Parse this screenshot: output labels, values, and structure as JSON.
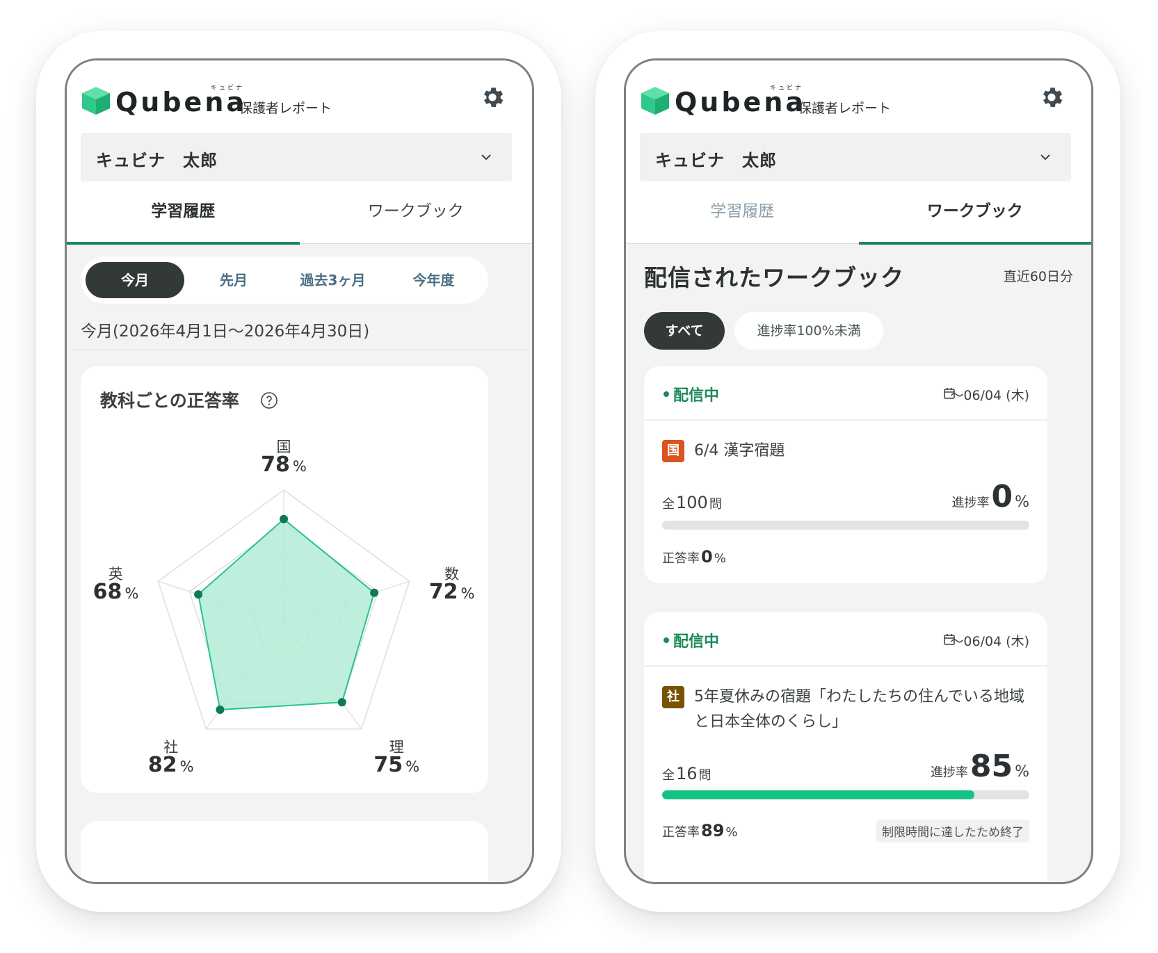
{
  "app": {
    "logo_ruby": "キュビナ",
    "logo_word": "Qubena",
    "logo_sub": "保護者レポート",
    "gear_icon": "gear-icon",
    "child_name": "キュビナ　太郎"
  },
  "tabs": [
    "学習履歴",
    "ワークブック"
  ],
  "history": {
    "periods": [
      "今月",
      "先月",
      "過去3ヶ月",
      "今年度"
    ],
    "selected_period": "今月",
    "range": "今月(2026年4月1日〜2026年4月30日)",
    "card_title": "教科ごとの正答率",
    "pct_unit": "%",
    "subjects": [
      {
        "name": "国",
        "value": 78
      },
      {
        "name": "数",
        "value": 72
      },
      {
        "name": "理",
        "value": 75
      },
      {
        "name": "社",
        "value": 82
      },
      {
        "name": "英",
        "value": 68
      }
    ]
  },
  "workbook": {
    "title": "配信されたワークブック",
    "note": "直近60日分",
    "filters": [
      "すべて",
      "進捗率100%未満"
    ],
    "total_prefix": "全",
    "total_suffix": "問",
    "progress_label": "進捗率",
    "accuracy_label": "正答率",
    "pct_unit": "%",
    "items": [
      {
        "status": "配信中",
        "due": "〜06/04 (木)",
        "subject": "国",
        "subject_color": "#d9541e",
        "name": "6/4 漢字宿題",
        "total": "100",
        "progress": "0",
        "progress_fraction": 0,
        "accuracy": "0"
      },
      {
        "status": "配信中",
        "due": "〜06/04 (木)",
        "subject": "社",
        "subject_color": "#7a5200",
        "name": "5年夏休みの宿題「わたしたちの住んでいる地域と日本全体のくらし」",
        "total": "16",
        "progress": "85",
        "progress_fraction": 0.85,
        "accuracy": "89",
        "note": "制限時間に達したため終了"
      }
    ]
  },
  "colors": {
    "accent": "#1b8a5a",
    "progress_fill": "#14c384",
    "radar_fill": "#b3ecd6",
    "radar_stroke": "#27c48b",
    "selected_chip": "#333838"
  }
}
